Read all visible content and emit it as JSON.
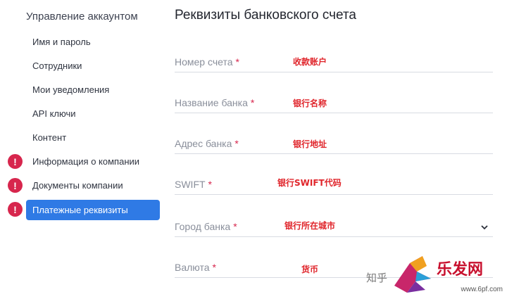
{
  "sidebar": {
    "title": "Управление аккаунтом",
    "items": [
      {
        "label": "Имя и пароль"
      },
      {
        "label": "Сотрудники"
      },
      {
        "label": "Мои уведомления"
      },
      {
        "label": "API ключи"
      },
      {
        "label": "Контент"
      },
      {
        "label": "Информация о компании",
        "alert": "!"
      },
      {
        "label": "Документы компании",
        "alert": "!"
      },
      {
        "label": "Платежные реквизиты",
        "alert": "!"
      }
    ]
  },
  "main": {
    "title": "Реквизиты банковского счета",
    "required_mark": "*",
    "fields": [
      {
        "label": "Номер счета",
        "note": "收款账户"
      },
      {
        "label": "Название банка",
        "note": "银行名称"
      },
      {
        "label": "Адрес банка",
        "note": "银行地址"
      },
      {
        "label": "SWIFT",
        "note": "银行SWIFT代码"
      },
      {
        "label": "Город банка",
        "note": "银行所在城市"
      },
      {
        "label": "Валюта",
        "note": "货币"
      }
    ]
  },
  "watermark": {
    "logo_text": "乐发网",
    "url": "www.6pf.com",
    "zhihu_text": "知乎"
  },
  "colors": {
    "accent": "#2f7ae5",
    "alert": "#d7264d",
    "note": "#e0252b"
  }
}
